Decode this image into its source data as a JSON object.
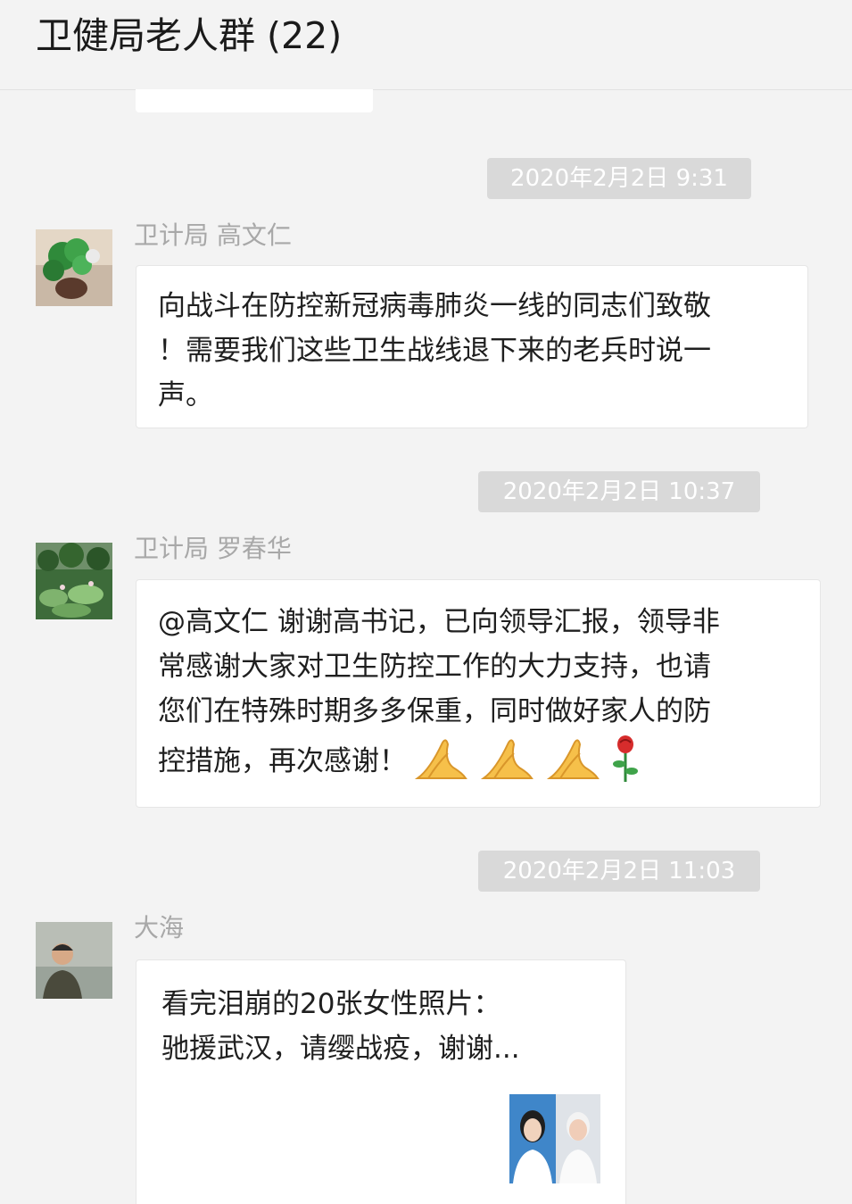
{
  "header": {
    "title": "卫健局老人群 (22)"
  },
  "messages": [
    {
      "timestamp": "2020年2月2日 9:31",
      "sender": "卫计局 高文仁",
      "avatar_icon": "green-plant-avatar-icon",
      "lines": [
        "向战斗在防控新冠病毒肺炎一线的同志们致敬",
        "！需要我们这些卫生战线退下来的老兵时说一",
        "声。"
      ]
    },
    {
      "timestamp": "2020年2月2日 10:37",
      "sender": "卫计局 罗春华",
      "avatar_icon": "lotus-pond-avatar-icon",
      "lines": [
        "@高文仁 谢谢高书记，已向领导汇报，领导非",
        "常感谢大家对卫生防控工作的大力支持，也请",
        "您们在特殊时期多多保重，同时做好家人的防",
        "控措施，再次感谢！"
      ],
      "emojis": [
        "praying-hands-icon",
        "praying-hands-icon",
        "praying-hands-icon",
        "rose-icon"
      ]
    },
    {
      "timestamp": "2020年2月2日 11:03",
      "sender": "大海",
      "avatar_icon": "man-portrait-avatar-icon",
      "lines": [
        "看完泪崩的20张女性照片：",
        "驰援武汉，请缨战疫，谢谢..."
      ],
      "thumbnail_icon": "women-photos-thumbnail-icon"
    }
  ],
  "colors": {
    "background": "#f3f3f3",
    "bubble": "#ffffff",
    "timestamp_bg": "#d9d9d9",
    "timestamp_text": "#ffffff",
    "sender_text": "#a8a8a8"
  }
}
